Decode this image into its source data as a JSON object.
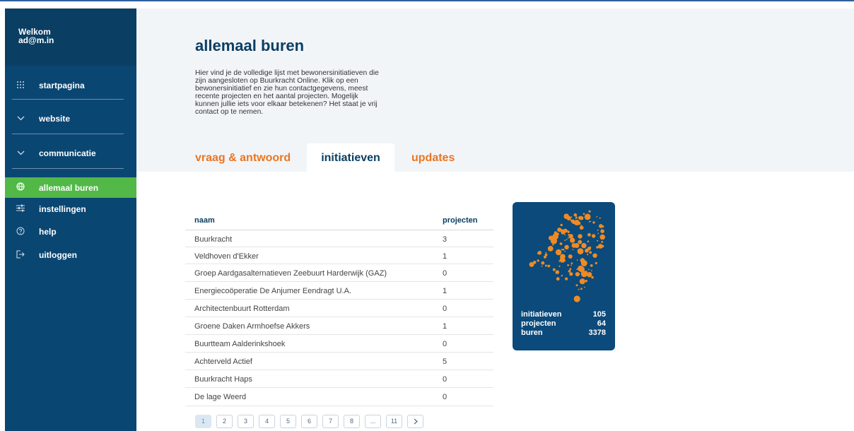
{
  "sidebar": {
    "welcome": "Welkom",
    "user": "ad@m.in",
    "items": [
      {
        "label": "startpagina",
        "icon": "grid-icon"
      },
      {
        "label": "website",
        "icon": "chevron-down-icon"
      },
      {
        "label": "communicatie",
        "icon": "chevron-down-icon"
      },
      {
        "label": "allemaal buren",
        "icon": "globe-icon"
      },
      {
        "label": "instellingen",
        "icon": "sliders-icon"
      },
      {
        "label": "help",
        "icon": "help-icon"
      },
      {
        "label": "uitloggen",
        "icon": "logout-icon"
      }
    ],
    "active_color": "#52b848",
    "bg_color": "#0a4672"
  },
  "page": {
    "title": "allemaal buren",
    "intro_lines": [
      "Hier vind je de volledige lijst met bewonersinitiatieven die",
      "zijn aangesloten op Buurkracht Online. Klik op een",
      "bewonersinitiatief en zie hun contactgegevens, meest",
      "recente projecten en het aantal projecten. Mogelijk",
      "kunnen jullie iets voor elkaar betekenen? Het staat je vrij",
      "contact op te nemen."
    ]
  },
  "tabs": [
    {
      "label": "vraag & antwoord",
      "active": false
    },
    {
      "label": "initiatieven",
      "active": true
    },
    {
      "label": "updates",
      "active": false
    }
  ],
  "table": {
    "headers": {
      "name": "naam",
      "projects": "projecten"
    },
    "rows": [
      {
        "name": "Buurkracht",
        "projects": "3"
      },
      {
        "name": "Veldhoven d'Ekker",
        "projects": "1"
      },
      {
        "name": "Groep Aardgasalternatieven Zeebuurt Harderwijk (GAZ)",
        "projects": "0"
      },
      {
        "name": "Energiecoöperatie De Anjumer Eendragt U.A.",
        "projects": "1"
      },
      {
        "name": "Architectenbuurt Rotterdam",
        "projects": "0"
      },
      {
        "name": "Groene Daken Armhoefse Akkers",
        "projects": "1"
      },
      {
        "name": "Buurtteam Aalderinkshoek",
        "projects": "0"
      },
      {
        "name": "Achterveld Actief",
        "projects": "5"
      },
      {
        "name": "Buurkracht Haps",
        "projects": "0"
      },
      {
        "name": "De lage Weerd",
        "projects": "0"
      }
    ]
  },
  "pagination": {
    "pages": [
      "1",
      "2",
      "3",
      "4",
      "5",
      "6",
      "7",
      "8",
      "...",
      "11"
    ],
    "current": "1",
    "next_icon": "chevron-right-icon"
  },
  "stats": {
    "map_icon": "netherlands-dot-map",
    "items": [
      {
        "label": "initiatieven",
        "value": "105"
      },
      {
        "label": "projecten",
        "value": "64"
      },
      {
        "label": "buren",
        "value": "3378"
      }
    ],
    "accent_color": "#f08a24"
  }
}
